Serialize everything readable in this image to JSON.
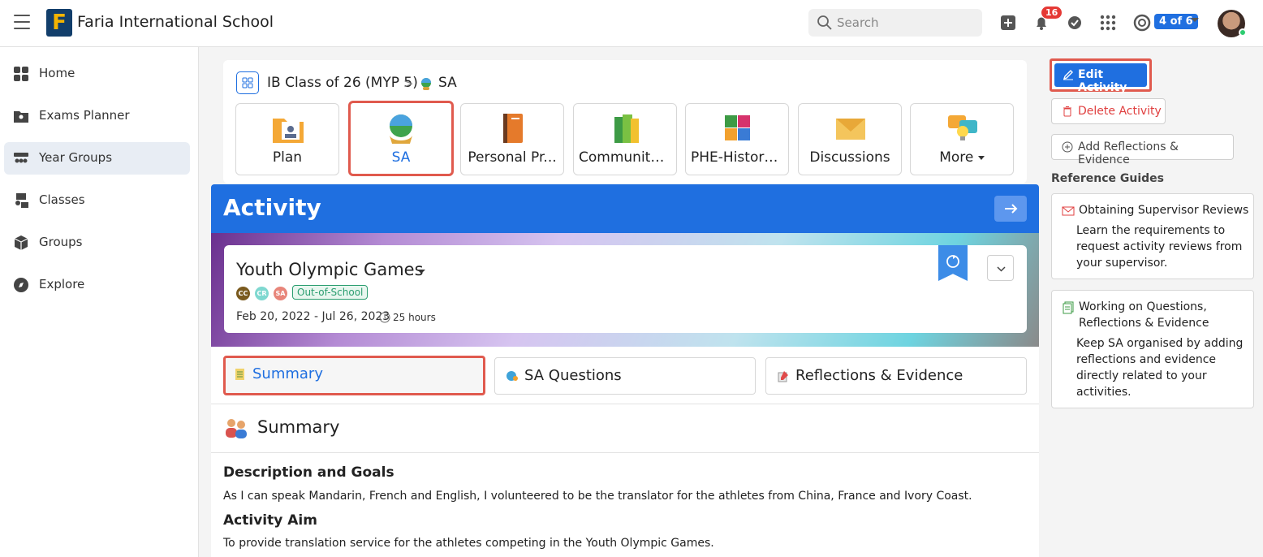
{
  "header": {
    "logo_letter": "F",
    "school_name": "Faria International School",
    "search_placeholder": "Search",
    "notification_count": "16",
    "pager": "4 of 6"
  },
  "sidebar": {
    "items": [
      {
        "label": "Home",
        "icon": "home-grid-icon"
      },
      {
        "label": "Exams Planner",
        "icon": "exams-folder-icon"
      },
      {
        "label": "Year Groups",
        "icon": "year-groups-icon"
      },
      {
        "label": "Classes",
        "icon": "classes-icon"
      },
      {
        "label": "Groups",
        "icon": "groups-cube-icon"
      },
      {
        "label": "Explore",
        "icon": "explore-compass-icon"
      }
    ],
    "active_index": 2
  },
  "breadcrumb": {
    "class_name": "IB Class of 26 (MYP 5)",
    "separator": ">",
    "current": "SA"
  },
  "tiles": [
    {
      "label": "Plan"
    },
    {
      "label": "SA"
    },
    {
      "label": "Personal Pr..."
    },
    {
      "label": "Community ..."
    },
    {
      "label": "PHE-History..."
    },
    {
      "label": "Discussions"
    },
    {
      "label": "More"
    }
  ],
  "activity": {
    "header": "Activity",
    "title": "Youth Olympic Games",
    "chips": [
      "CC",
      "CR",
      "SA"
    ],
    "tag": "Out-of-School",
    "dates": "Feb 20, 2022 - Jul 26, 2023",
    "hours": "25 hours"
  },
  "tabs": [
    {
      "label": "Summary"
    },
    {
      "label": "SA Questions"
    },
    {
      "label": "Reflections & Evidence"
    }
  ],
  "summary": {
    "title": "Summary",
    "desc_heading": "Description and Goals",
    "desc_text": "As I can speak Mandarin, French and English, I volunteered to be the translator for the athletes from China, France and Ivory Coast.",
    "aim_heading": "Activity Aim",
    "aim_text": "To provide translation service for the athletes competing in the Youth Olympic Games."
  },
  "actions": {
    "edit": "Edit Activity",
    "delete": "Delete Activity",
    "add": "Add Reflections & Evidence"
  },
  "reference": {
    "heading": "Reference Guides",
    "guides": [
      {
        "title": "Obtaining Supervisor Reviews",
        "desc": "Learn the requirements to request activity reviews from your supervisor."
      },
      {
        "title": "Working on Questions, Reflections & Evidence",
        "desc": "Keep SA organised by adding reflections and evidence directly related to your activities."
      }
    ]
  },
  "colors": {
    "accent": "#1f6fe0",
    "highlight": "#e05a4e",
    "delete": "#e04040",
    "tag": "#2a9d6f"
  }
}
